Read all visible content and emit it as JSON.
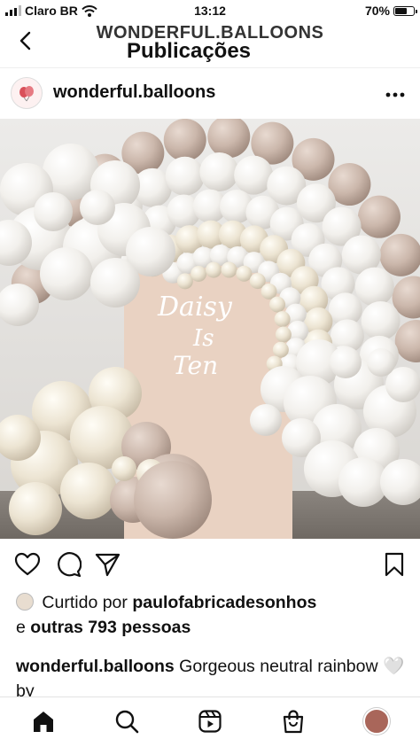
{
  "status_bar": {
    "carrier": "Claro BR",
    "time": "13:12",
    "battery": "70%",
    "battery_level": 0.7
  },
  "header": {
    "account": "WONDERFUL.BALLOONS",
    "title": "Publicações"
  },
  "post": {
    "username": "wonderful.balloons",
    "sign_text": [
      "Daisy",
      "Is",
      "Ten"
    ],
    "likes_prefix": "Curtido por",
    "liked_by": "paulofabricadesonhos",
    "likes_joiner": "e",
    "others": "outras 793 pessoas",
    "caption_user": "wonderful.balloons",
    "caption_text": "Gorgeous neutral rainbow 🤍 by"
  },
  "icons": {
    "back": "chevron-left-icon",
    "more": "more-horizontal-icon",
    "like": "heart-icon",
    "comment": "comment-icon",
    "share": "send-icon",
    "save": "bookmark-icon",
    "home": "home-icon",
    "search": "search-icon",
    "reels": "reels-icon",
    "shop": "shopping-bag-icon",
    "profile": "profile-avatar-icon"
  },
  "colors": {
    "text": "#111111",
    "backdrop": "#e9d2c2",
    "balloon_white": "#f4f2ee",
    "balloon_taupe": "#c9b6aa"
  }
}
